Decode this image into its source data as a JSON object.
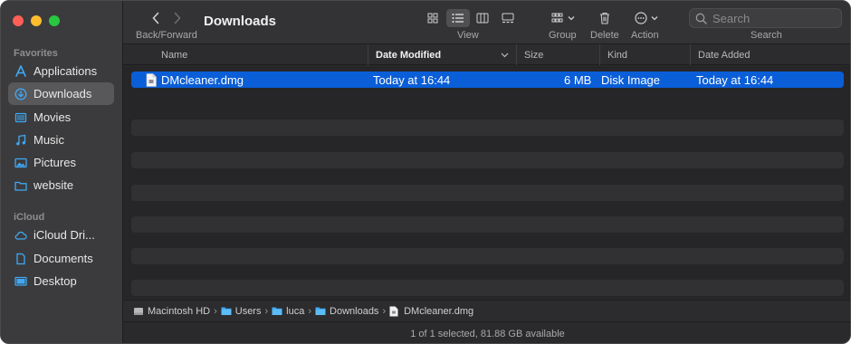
{
  "window": {
    "title": "Downloads"
  },
  "sidebar": {
    "favorites_label": "Favorites",
    "icloud_label": "iCloud",
    "favorites": [
      {
        "label": "Applications",
        "icon": "applications-icon"
      },
      {
        "label": "Downloads",
        "icon": "downloads-icon",
        "selected": true
      },
      {
        "label": "Movies",
        "icon": "movies-icon"
      },
      {
        "label": "Music",
        "icon": "music-icon"
      },
      {
        "label": "Pictures",
        "icon": "pictures-icon"
      },
      {
        "label": "website",
        "icon": "folder-icon"
      }
    ],
    "icloud": [
      {
        "label": "iCloud Dri...",
        "icon": "icloud-icon"
      },
      {
        "label": "Documents",
        "icon": "document-icon"
      },
      {
        "label": "Desktop",
        "icon": "desktop-icon"
      }
    ]
  },
  "toolbar": {
    "back_forward_label": "Back/Forward",
    "view_label": "View",
    "group_label": "Group",
    "delete_label": "Delete",
    "action_label": "Action",
    "search_label": "Search",
    "search_placeholder": "Search"
  },
  "columns": {
    "name": "Name",
    "date_modified": "Date Modified",
    "size": "Size",
    "kind": "Kind",
    "date_added": "Date Added"
  },
  "files": [
    {
      "name": "DMcleaner.dmg",
      "date_modified": "Today at 16:44",
      "size": "6 MB",
      "kind": "Disk Image",
      "date_added": "Today at 16:44"
    }
  ],
  "pathbar": {
    "items": [
      "Macintosh HD",
      "Users",
      "luca",
      "Downloads",
      "DMcleaner.dmg"
    ]
  },
  "status": {
    "text": "1 of 1 selected, 81.88 GB available"
  },
  "colors": {
    "accent": "#0a5ed7",
    "folder": "#3fa9f5"
  }
}
